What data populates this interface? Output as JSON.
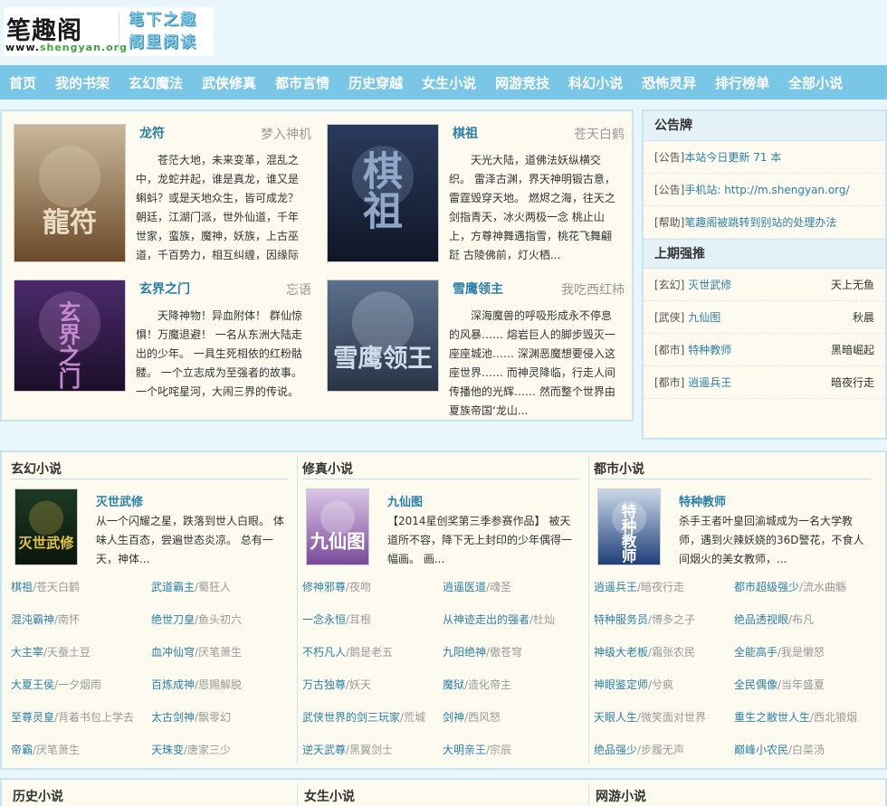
{
  "header": {
    "logo_main": "笔趣阁",
    "logo_url_prefix": "www.",
    "logo_url_domain": "shengyan",
    "logo_url_suffix": ".org",
    "slogan_line1": "笔下之趣",
    "slogan_line2": "阁里阅读"
  },
  "nav": [
    "首页",
    "我的书架",
    "玄幻魔法",
    "武侠修真",
    "都市言情",
    "历史穿越",
    "女生小说",
    "网游竞技",
    "科幻小说",
    "恐怖灵异",
    "排行榜单",
    "全部小说"
  ],
  "featured": [
    {
      "title": "龙符",
      "author": "梦入神机",
      "desc": "苍茫大地，未来变革，混乱之中，龙蛇并起，谁是真龙，谁又是蝌蚪？或是天地众生，皆可成龙？朝廷，江湖门派，世外仙道，千年世家，蛮族，魔神，妖族，上古巫道，千百势力，相互纠缠，因缘际",
      "cover_text": "龍符"
    },
    {
      "title": "棋祖",
      "author": "苍天白鹤",
      "desc": "天光大陆，道佛法妖纵横交织。 雷泽古渊，界天神明锻古意，雷霆毁穿天地。 燃烬之海，往天之剑指青天，冰火两极一念 桃止山上，方尊神舞遇指雪，桃花飞舞翩跹 古陵佛前，灯火栖...",
      "cover_text": "棋祖"
    },
    {
      "title": "玄界之门",
      "author": "忘语",
      "desc": "天降神物！异血附体！ 群仙惊惧！万魔退避！ 一名从东洲大陆走出的少年。 一具生死相依的红粉骷髅。 一个立志成为至强者的故事。 一个叱咤星河，大闹三界的传说。",
      "cover_text": "玄界之门"
    },
    {
      "title": "雪鹰领主",
      "author": "我吃西红柿",
      "desc": "深海魔兽的呼吸形成永不停息的风暴…… 熔岩巨人的脚步毁灭一座座城池…… 深渊恶魔想要侵入这座世界…… 而神灵降临，行走人间传播他的光辉…… 然而整个世界由夏族帝国‘龙山...",
      "cover_text": "雪鹰领王"
    }
  ],
  "notice": {
    "title": "公告牌",
    "items": [
      {
        "tag": "[公告]",
        "text": "本站今日更新 71 本"
      },
      {
        "tag": "[公告]",
        "text": "手机站: http://m.shengyan.org/"
      },
      {
        "tag": "[帮助]",
        "text": "笔趣阁被跳转到别站的处理办法"
      }
    ]
  },
  "last_period": {
    "title": "上期强推",
    "items": [
      {
        "cat": "[玄幻]",
        "title": "灭世武修",
        "author": "天上无鱼"
      },
      {
        "cat": "[武侠]",
        "title": "九仙图",
        "author": "秋晨"
      },
      {
        "cat": "[都市]",
        "title": "特种教师",
        "author": "黑暗崛起"
      },
      {
        "cat": "[都市]",
        "title": "逍遥兵王",
        "author": "暗夜行走"
      }
    ]
  },
  "categories": [
    {
      "name": "玄幻小说",
      "top_title": "灭世武修",
      "top_desc": "从一个闪耀之星，跌落到世人白眼。 体味人生百态，尝遍世态炎凉。 总有一天，神体...",
      "cover_text": "灭世武修",
      "list": [
        {
          "t": "棋祖",
          "a": "苍天白鹤"
        },
        {
          "t": "武道霸主",
          "a": "蜀狂人"
        },
        {
          "t": "混沌霸神",
          "a": "南怀"
        },
        {
          "t": "绝世刀皇",
          "a": "鱼头初六"
        },
        {
          "t": "大主宰",
          "a": "天蚕土豆"
        },
        {
          "t": "血冲仙穹",
          "a": "厌笔萧生"
        },
        {
          "t": "大夏王侯",
          "a": "一夕烟雨"
        },
        {
          "t": "百炼成神",
          "a": "恩赐解脱"
        },
        {
          "t": "至尊灵皇",
          "a": "背着书包上学去"
        },
        {
          "t": "太古剑神",
          "a": "飘零幻"
        },
        {
          "t": "帝霸",
          "a": "厌笔萧生"
        },
        {
          "t": "天珠变",
          "a": "唐家三少"
        }
      ]
    },
    {
      "name": "修真小说",
      "top_title": "九仙图",
      "top_desc": "【2014星创奖第三季参赛作品】 被天道所不容，降下无上封印的少年偶得一幅画。 画...",
      "cover_text": "九仙图",
      "list": [
        {
          "t": "修神邪尊",
          "a": "夜吻"
        },
        {
          "t": "逍遥医道",
          "a": "魂圣"
        },
        {
          "t": "一念永恒",
          "a": "耳根"
        },
        {
          "t": "从神迹走出的强者",
          "a": "杜灿"
        },
        {
          "t": "不朽凡人",
          "a": "鹅是老五"
        },
        {
          "t": "九阳绝神",
          "a": "傲苍穹"
        },
        {
          "t": "万古独尊",
          "a": "妖天"
        },
        {
          "t": "魔狱",
          "a": "造化帝主"
        },
        {
          "t": "武侠世界的剑三玩家",
          "a": "荒城"
        },
        {
          "t": "剑神",
          "a": "西风怒"
        },
        {
          "t": "逆天武尊",
          "a": "黑翼剑士"
        },
        {
          "t": "大明亲王",
          "a": "宗辰"
        }
      ]
    },
    {
      "name": "都市小说",
      "top_title": "特种教师",
      "top_desc": "杀手王者叶皇回渝城成为一名大学教师，遇到火辣妖娆的36D警花，不食人间烟火的美女教师，...",
      "cover_text": "特种教师",
      "list": [
        {
          "t": "逍遥兵王",
          "a": "暗夜行走"
        },
        {
          "t": "都市超级强少",
          "a": "流水曲觞"
        },
        {
          "t": "特种服务员",
          "a": "博多之子"
        },
        {
          "t": "绝品透视眼",
          "a": "布凡"
        },
        {
          "t": "神级大老板",
          "a": "霜张农民"
        },
        {
          "t": "全能高手",
          "a": "我是懒怒"
        },
        {
          "t": "神眼鉴定师",
          "a": "兮疯"
        },
        {
          "t": "全民偶像",
          "a": "当年盛夏"
        },
        {
          "t": "天眼人生",
          "a": "微笑面对世界"
        },
        {
          "t": "重生之敝世人生",
          "a": "西北狼烟"
        },
        {
          "t": "绝品强少",
          "a": "步履无声"
        },
        {
          "t": "巅峰小农民",
          "a": "白菜汤"
        }
      ]
    }
  ],
  "bottom_heads": [
    "历史小说",
    "女生小说",
    "网游小说"
  ]
}
